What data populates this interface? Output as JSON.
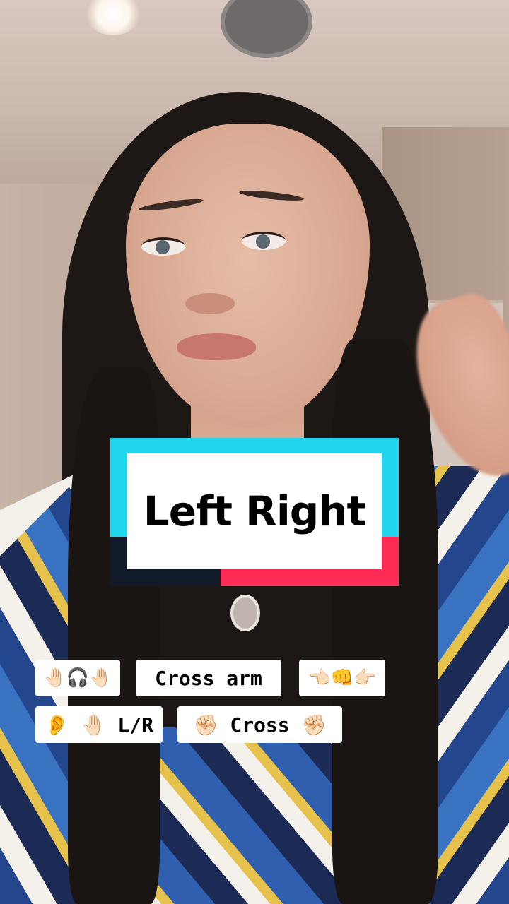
{
  "overlay": {
    "title": "Left Right",
    "colors": {
      "cyan": "#20d5ec",
      "pink": "#fe2c55",
      "dark": "#111a28",
      "chip_bg": "#ffffff"
    }
  },
  "chips": [
    {
      "text": "🤚🏻🎧🤚🏻"
    },
    {
      "text": "Cross arm"
    },
    {
      "text": "👈🏻👊👉🏻"
    },
    {
      "text": "👂 🤚🏻 L/R"
    },
    {
      "text": "✊🏻 Cross ✊🏻"
    }
  ]
}
